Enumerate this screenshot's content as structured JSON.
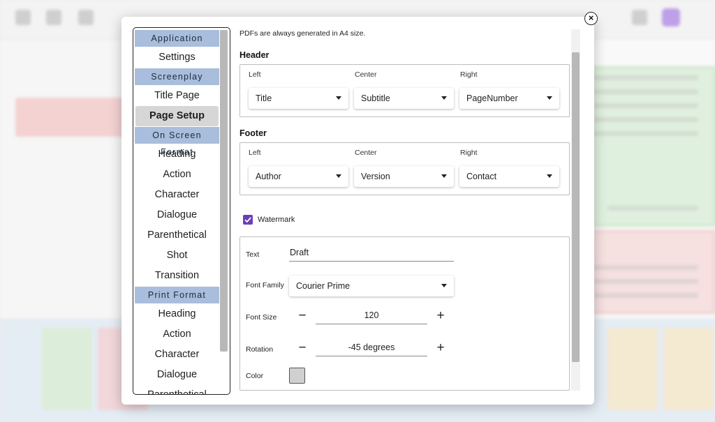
{
  "dialog": {
    "close_label": "×",
    "sidebar": {
      "sections": [
        {
          "header": "Application",
          "items": [
            {
              "label": "Settings",
              "active": false
            }
          ]
        },
        {
          "header": "Screenplay",
          "items": [
            {
              "label": "Title Page",
              "active": false
            },
            {
              "label": "Page Setup",
              "active": true
            }
          ]
        },
        {
          "header": "On Screen Format",
          "items": [
            {
              "label": "Heading"
            },
            {
              "label": "Action"
            },
            {
              "label": "Character"
            },
            {
              "label": "Dialogue"
            },
            {
              "label": "Parenthetical"
            },
            {
              "label": "Shot"
            },
            {
              "label": "Transition"
            }
          ]
        },
        {
          "header": "Print Format",
          "items": [
            {
              "label": "Heading"
            },
            {
              "label": "Action"
            },
            {
              "label": "Character"
            },
            {
              "label": "Dialogue"
            },
            {
              "label": "Parenthetical"
            }
          ]
        }
      ]
    },
    "content": {
      "note": "PDFs are always generated in A4 size.",
      "header": {
        "title": "Header",
        "left_label": "Left",
        "center_label": "Center",
        "right_label": "Right",
        "left_value": "Title",
        "center_value": "Subtitle",
        "right_value": "PageNumber"
      },
      "footer": {
        "title": "Footer",
        "left_label": "Left",
        "center_label": "Center",
        "right_label": "Right",
        "left_value": "Author",
        "center_value": "Version",
        "right_value": "Contact"
      },
      "watermark": {
        "checkbox_label": "Watermark",
        "checked": true,
        "text_label": "Text",
        "text_value": "Draft",
        "font_family_label": "Font Family",
        "font_family_value": "Courier Prime",
        "font_size_label": "Font Size",
        "font_size_value": "120",
        "rotation_label": "Rotation",
        "rotation_value": "-45 degrees",
        "color_label": "Color",
        "color_value": "#d0d0d0",
        "minus": "−",
        "plus": "+"
      }
    }
  },
  "colors": {
    "section_header_bg": "#a9bddc",
    "accent": "#6b3fb8"
  }
}
